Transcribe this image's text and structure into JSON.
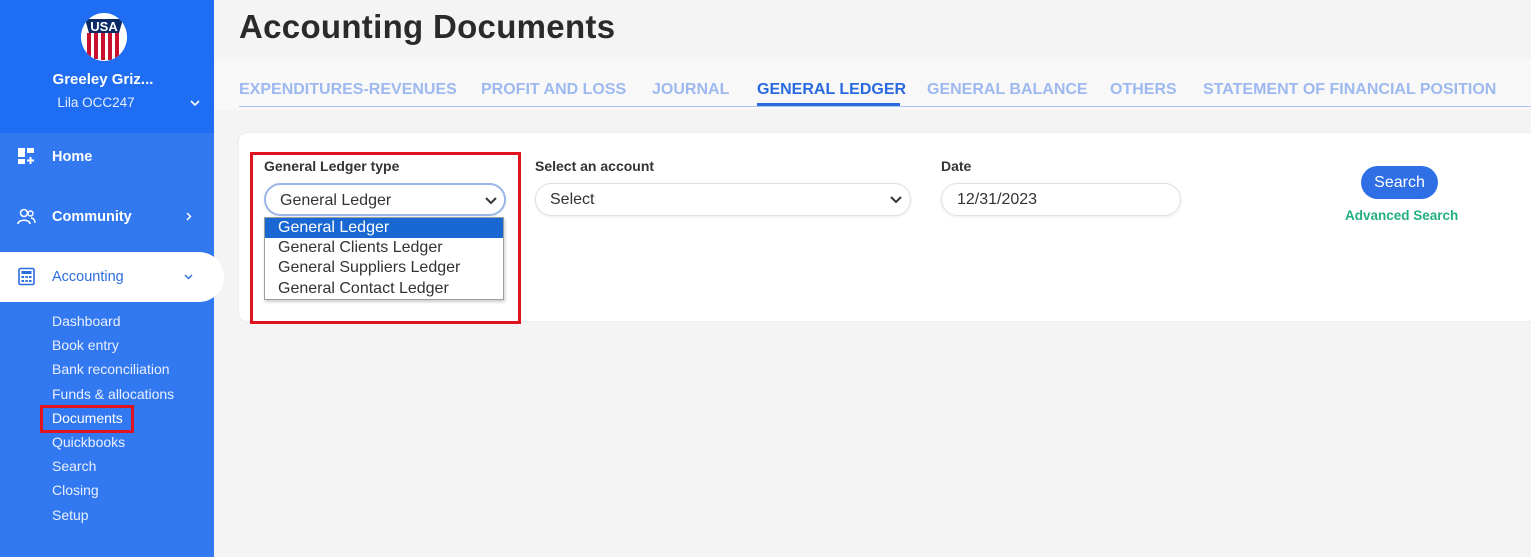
{
  "sidebar": {
    "org_name": "Greeley Griz...",
    "org_user": "Lila OCC247",
    "nav": [
      {
        "label": "Home",
        "icon": "dashboard-add-icon"
      },
      {
        "label": "Community",
        "icon": "users-icon"
      },
      {
        "label": "Accounting",
        "icon": "calculator-icon"
      }
    ],
    "sub_items": [
      "Dashboard",
      "Book entry",
      "Bank reconciliation",
      "Funds & allocations",
      "Documents",
      "Quickbooks",
      "Search",
      "Closing",
      "Setup"
    ]
  },
  "page": {
    "title": "Accounting Documents"
  },
  "tabs": [
    "EXPENDITURES-REVENUES",
    "PROFIT AND LOSS",
    "JOURNAL",
    "GENERAL LEDGER",
    "GENERAL BALANCE",
    "OTHERS",
    "STATEMENT OF FINANCIAL POSITION"
  ],
  "active_tab": "GENERAL LEDGER",
  "form": {
    "ledger_type_label": "General Ledger type",
    "ledger_type_value": "General Ledger",
    "ledger_type_options": [
      "General Ledger",
      "General Clients Ledger",
      "General Suppliers Ledger",
      "General Contact Ledger"
    ],
    "account_label": "Select an account",
    "account_value": "Select",
    "date_label": "Date",
    "date_value": "12/31/2023",
    "search_label": "Search",
    "advanced_search_label": "Advanced Search"
  },
  "colors": {
    "sidebar": "#3278f0",
    "accent": "#2a6ae0",
    "highlight": "#e0141e",
    "advanced_search": "#22b07d"
  }
}
